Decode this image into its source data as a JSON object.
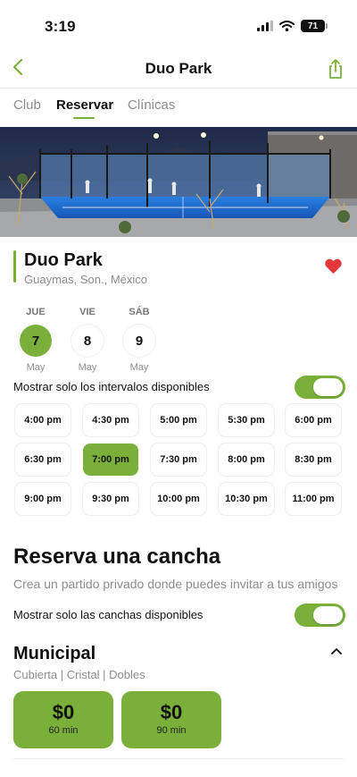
{
  "status": {
    "time": "3:19",
    "battery": "71"
  },
  "nav": {
    "title": "Duo Park"
  },
  "tabs": [
    {
      "label": "Club"
    },
    {
      "label": "Reservar"
    },
    {
      "label": "Clínicas"
    }
  ],
  "club": {
    "name": "Duo Park",
    "location": "Guaymas, Son., México"
  },
  "dates": [
    {
      "dow": "JUE",
      "day": "7",
      "month": "May"
    },
    {
      "dow": "VIE",
      "day": "8",
      "month": "May"
    },
    {
      "dow": "SÁB",
      "day": "9",
      "month": "May"
    }
  ],
  "slots_toggle": {
    "label": "Mostrar solo los intervalos disponibles",
    "on": true
  },
  "slots": [
    "4:00 pm",
    "4:30 pm",
    "5:00 pm",
    "5:30 pm",
    "6:00 pm",
    "6:30 pm",
    "7:00 pm",
    "7:30 pm",
    "8:00 pm",
    "8:30 pm",
    "9:00 pm",
    "9:30 pm",
    "10:00 pm",
    "10:30 pm",
    "11:00 pm"
  ],
  "selected_slot": "7:00 pm",
  "reserve": {
    "title": "Reserva una cancha",
    "subtitle": "Crea un partido privado donde puedes invitar a tus amigos"
  },
  "courts_toggle": {
    "label": "Mostrar solo las canchas disponibles",
    "on": true
  },
  "court": {
    "name": "Municipal",
    "specs": "Cubierta | Cristal | Dobles",
    "prices": [
      {
        "price": "$0",
        "duration": "60 min"
      },
      {
        "price": "$0",
        "duration": "90 min"
      }
    ]
  },
  "colors": {
    "accent": "#7ab03a",
    "heart": "#e5383b",
    "muted": "#8d8d8d"
  },
  "icons": {
    "back": "chevron-left-icon",
    "share": "share-icon",
    "favorite": "heart-icon",
    "collapse": "chevron-up-icon"
  }
}
